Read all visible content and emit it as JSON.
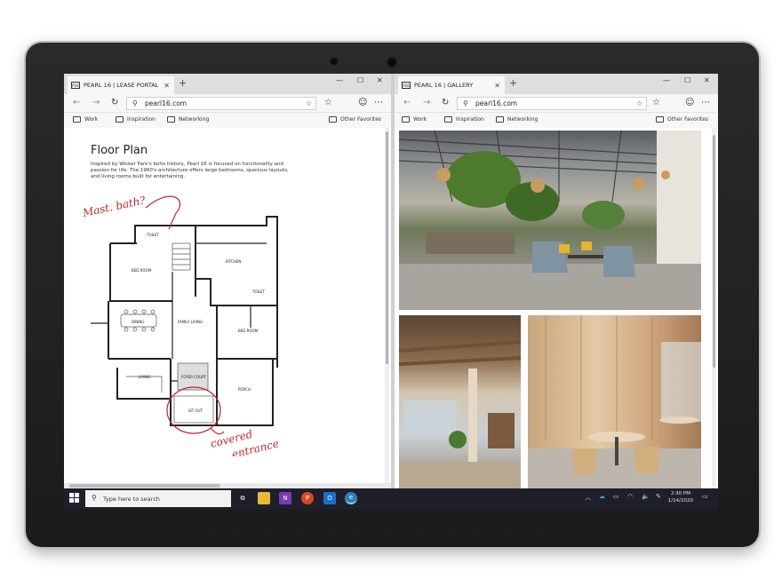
{
  "left_window": {
    "tab_title": "PEARL 16 | LEASE PORTAL",
    "favicon_text": "P16",
    "url": "pearl16.com",
    "favorites": [
      "Work",
      "Inspiration",
      "Networking"
    ],
    "other_favorites": "Other Favorites",
    "page": {
      "title": "Floor Plan",
      "description": "Inspired by Wicker Park's boho history, Pearl 16 is focused on functionality and passion for life. The 1960's architecture offers large bedrooms, spacious layouts, and living rooms built for entertaining."
    },
    "floorplan_labels": {
      "toilet_top": "TOILET",
      "bedroom_left": "BED ROOM",
      "kitchen": "KITCHEN",
      "toilet_right": "TOILET",
      "dining": "DINING",
      "family_living": "FAMILY LIVING",
      "bedroom_right": "BED ROOM",
      "foyer": "FOYER COURT",
      "living": "LIVING",
      "porch": "PORCH",
      "sit_out": "SIT OUT"
    },
    "ink_annotations": {
      "note_top": "Mast. bath?",
      "note_bottom_1": "covered",
      "note_bottom_2": "entrance"
    }
  },
  "right_window": {
    "tab_title": "PEARL 16 | GALLERY",
    "favicon_text": "P16",
    "url": "pearl16.com",
    "favorites": [
      "Work",
      "Inspiration",
      "Networking"
    ],
    "other_favorites": "Other Favorites"
  },
  "taskbar": {
    "search_placeholder": "Type here to search",
    "time": "2:30 PM",
    "date": "1/14/2020"
  },
  "colors": {
    "ink": "#c0262e",
    "taskbar": "#1e1f2b",
    "bezel": "#1f1f21"
  }
}
